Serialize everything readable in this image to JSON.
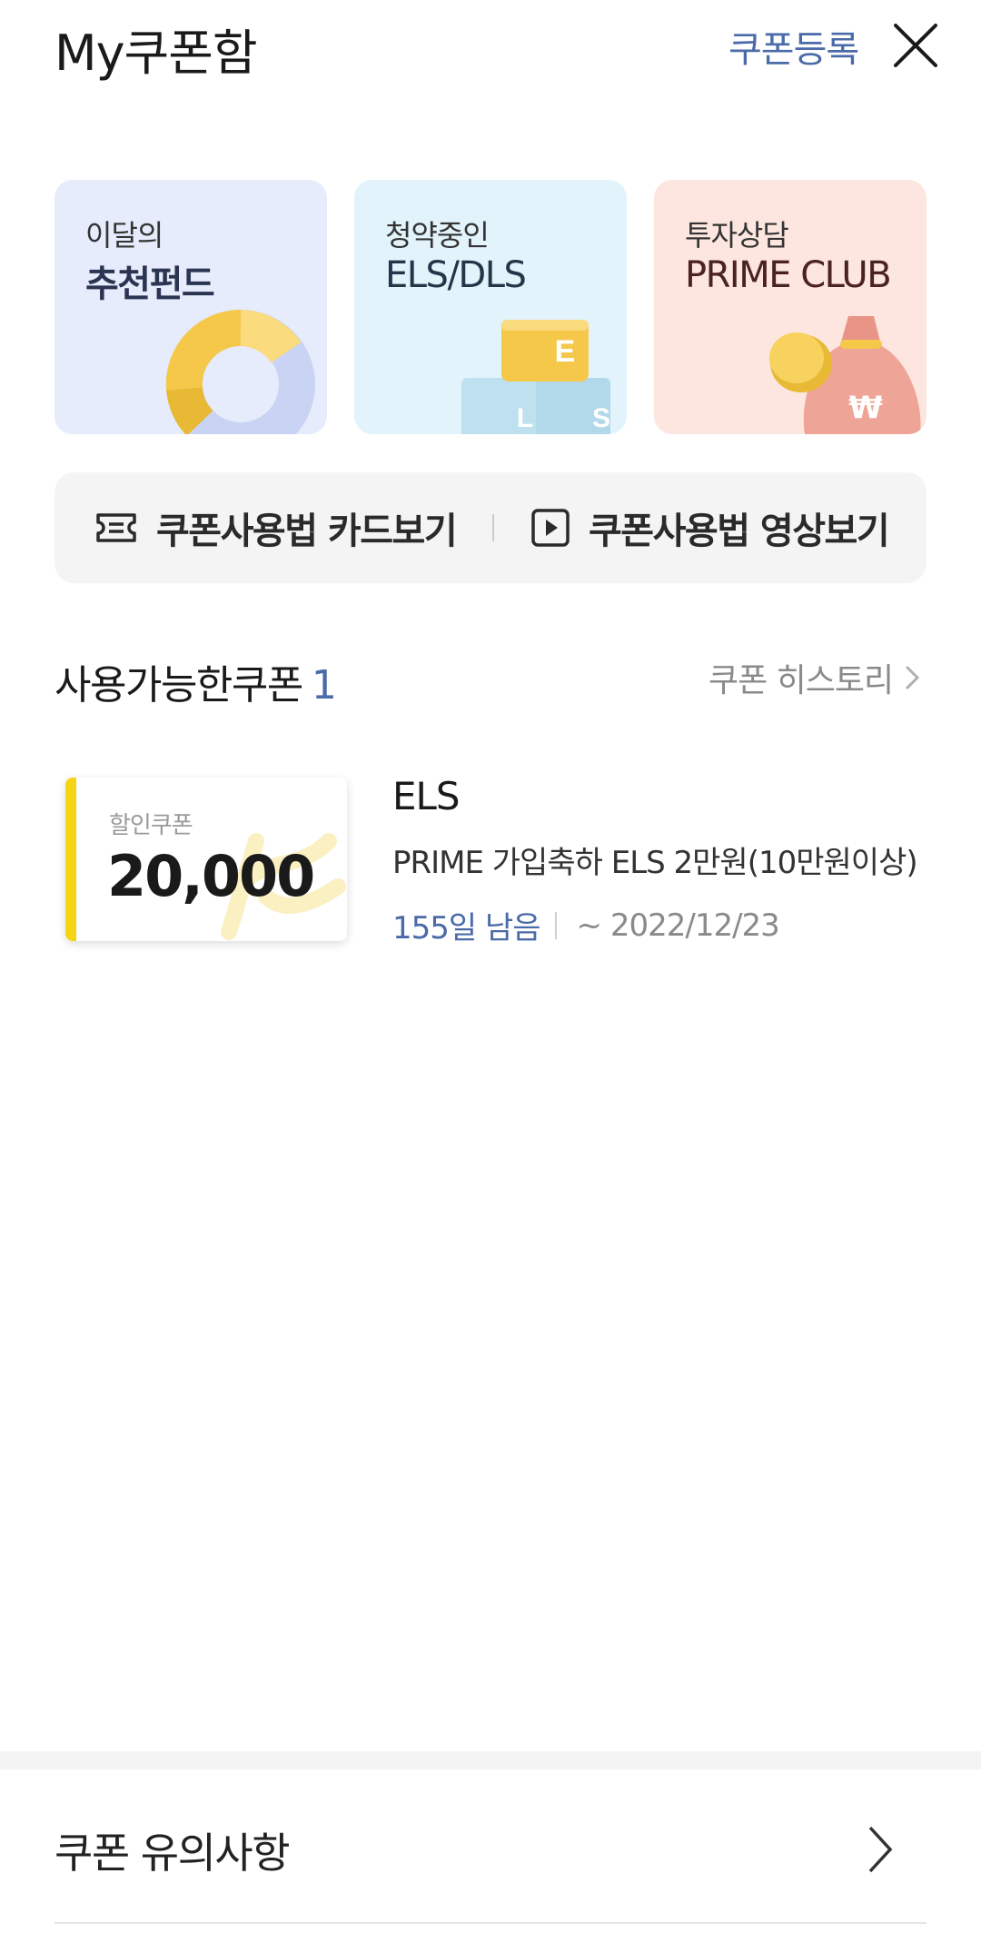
{
  "header": {
    "title": "My쿠폰함",
    "register_label": "쿠폰등록",
    "close_icon": "close-icon"
  },
  "promos": [
    {
      "sub": "이달의",
      "main": "추천펀드",
      "icon": "donut-chart-icon",
      "bg": "#e6ecfb"
    },
    {
      "sub": "청약중인",
      "main": "ELS/DLS",
      "icon": "letter-blocks-icon",
      "bg": "#e2f3fb",
      "blocks": [
        "E",
        "L",
        "S"
      ]
    },
    {
      "sub": "투자상담",
      "main": "PRIME CLUB",
      "icon": "money-bag-icon",
      "bg": "#fde6df",
      "bag_symbol": "₩"
    }
  ],
  "guide": {
    "card_label": "쿠폰사용법 카드보기",
    "video_label": "쿠폰사용법 영상보기"
  },
  "section": {
    "title": "사용가능한쿠폰",
    "count": "1",
    "history_label": "쿠폰 히스토리"
  },
  "coupon": {
    "type": "할인쿠폰",
    "amount": "20,000",
    "title": "ELS",
    "description": "PRIME 가입축하 ELS 2만원(10만원이상)",
    "days_left": "155일 남음",
    "expiry": "~ 2022/12/23",
    "stripe_color": "#f7d515"
  },
  "footer": {
    "notice_label": "쿠폰 유의사항"
  },
  "colors": {
    "accent": "#4a6aa8",
    "muted": "#8a8a8a"
  }
}
